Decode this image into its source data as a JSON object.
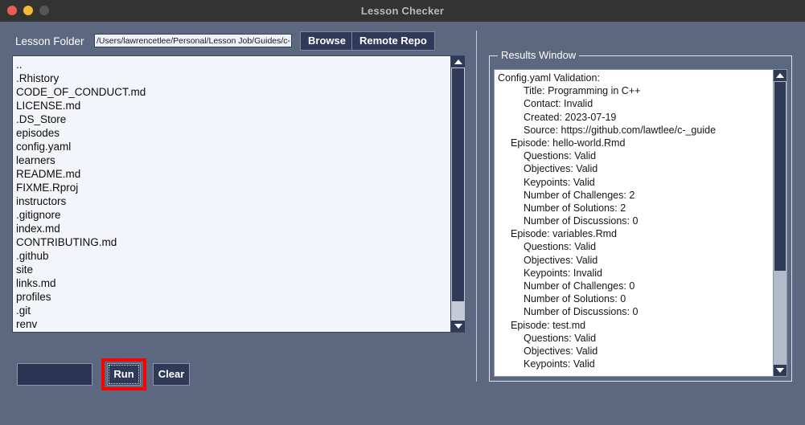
{
  "window": {
    "title": "Lesson Checker",
    "traffic_lights": [
      {
        "name": "close",
        "color": "#f05b51"
      },
      {
        "name": "minimize",
        "color": "#f7ba33"
      },
      {
        "name": "maximize",
        "color": "#565656"
      }
    ]
  },
  "theme": {
    "background": "#5b6880",
    "titlebar": "#333333",
    "button_face": "#2e3a58",
    "highlight": "#ff0000",
    "text_light": "#ffffff",
    "panel_white": "#ffffff"
  },
  "toolbar": {
    "folder_label": "Lesson Folder",
    "path_value": "/Users/lawrencetlee/Personal/Lesson Job/Guides/c-",
    "path_placeholder": "",
    "browse_label": "Browse",
    "remote_repo_label": "Remote Repo"
  },
  "file_list": {
    "items": [
      "..",
      ".Rhistory",
      "CODE_OF_CONDUCT.md",
      "LICENSE.md",
      ".DS_Store",
      "episodes",
      "config.yaml",
      "learners",
      "README.md",
      "FIXME.Rproj",
      "instructors",
      ".gitignore",
      "index.md",
      "CONTRIBUTING.md",
      ".github",
      "site",
      "links.md",
      "profiles",
      ".git",
      "renv"
    ]
  },
  "actions": {
    "blank_label": "",
    "run_label": "Run",
    "clear_label": "Clear"
  },
  "results": {
    "frame_label": "Results Window",
    "lines": [
      {
        "indent": 0,
        "text": "Config.yaml Validation:"
      },
      {
        "indent": 2,
        "text": "Title: Programming in C++"
      },
      {
        "indent": 2,
        "text": "Contact: Invalid"
      },
      {
        "indent": 2,
        "text": "Created: 2023-07-19"
      },
      {
        "indent": 2,
        "text": "Source: https://github.com/lawtlee/c-_guide"
      },
      {
        "indent": 1,
        "text": "Episode: hello-world.Rmd"
      },
      {
        "indent": 2,
        "text": "Questions: Valid"
      },
      {
        "indent": 2,
        "text": "Objectives: Valid"
      },
      {
        "indent": 2,
        "text": "Keypoints: Valid"
      },
      {
        "indent": 2,
        "text": "Number of Challenges: 2"
      },
      {
        "indent": 2,
        "text": "Number of Solutions: 2"
      },
      {
        "indent": 2,
        "text": "Number of Discussions: 0"
      },
      {
        "indent": 1,
        "text": "Episode: variables.Rmd"
      },
      {
        "indent": 2,
        "text": "Questions: Valid"
      },
      {
        "indent": 2,
        "text": "Objectives: Valid"
      },
      {
        "indent": 2,
        "text": "Keypoints: Invalid"
      },
      {
        "indent": 2,
        "text": "Number of Challenges: 0"
      },
      {
        "indent": 2,
        "text": "Number of Solutions: 0"
      },
      {
        "indent": 2,
        "text": "Number of Discussions: 0"
      },
      {
        "indent": 1,
        "text": "Episode: test.md"
      },
      {
        "indent": 2,
        "text": "Questions: Valid"
      },
      {
        "indent": 2,
        "text": "Objectives: Valid"
      },
      {
        "indent": 2,
        "text": "Keypoints: Valid"
      }
    ]
  },
  "scrollbars": {
    "file_list": {
      "up_icon": "triangle-up-icon",
      "down_icon": "triangle-down-icon"
    },
    "results": {
      "up_icon": "triangle-up-icon",
      "down_icon": "triangle-down-icon"
    }
  }
}
